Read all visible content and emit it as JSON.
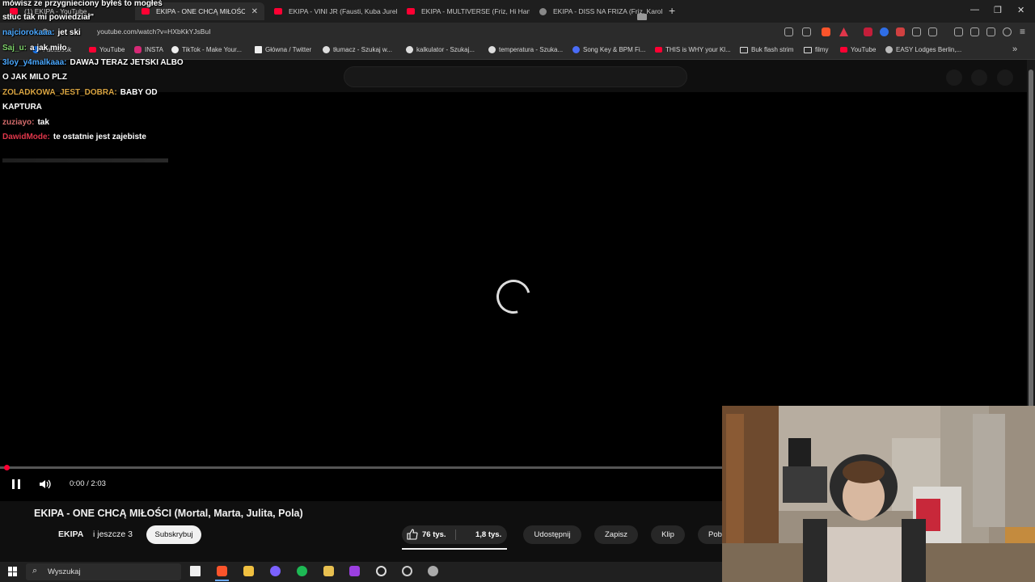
{
  "browser": {
    "tabs": [
      {
        "title": "(1) EKIPA - YouTube",
        "active": false
      },
      {
        "title": "EKIPA - ONE CHCĄ MIŁOŚCI (M",
        "active": true
      },
      {
        "title": "EKIPA - VINI JR (Fausti, Kuba Jurek) -",
        "active": false
      },
      {
        "title": "EKIPA - MULTIVERSE (Friz, Hi Hania, M",
        "active": false
      },
      {
        "title": "EKIPA - DISS NA FRIZA (Friz, Karol M",
        "active": false
      }
    ],
    "url": "youtube.com/watch?v=HXbKkYJsBuI",
    "bookmarks": [
      {
        "label": "Facebook",
        "icon": "facebook-icon"
      },
      {
        "label": "YouTube",
        "icon": "youtube-icon"
      },
      {
        "label": "INSTA",
        "icon": "instagram-icon"
      },
      {
        "label": "TikTok - Make Your...",
        "icon": "tiktok-icon"
      },
      {
        "label": "Główna / Twitter",
        "icon": "x-icon"
      },
      {
        "label": "tłumacz - Szukaj w...",
        "icon": "google-icon"
      },
      {
        "label": "kalkulator - Szukaj...",
        "icon": "google-icon"
      },
      {
        "label": "temperatura - Szuka...",
        "icon": "google-icon"
      },
      {
        "label": "Song Key & BPM Fi...",
        "icon": "music-icon"
      },
      {
        "label": "THIS is WHY your Kl...",
        "icon": "youtube-icon"
      },
      {
        "label": "Buk flash strim",
        "icon": "folder-icon"
      },
      {
        "label": "filmy",
        "icon": "folder-icon"
      },
      {
        "label": "YouTube",
        "icon": "youtube-icon"
      },
      {
        "label": "EASY Lodges Berlin,...",
        "icon": "globe-icon"
      }
    ]
  },
  "player": {
    "time": "0:00 / 2:03",
    "progress": 0.0,
    "state": "loading"
  },
  "video": {
    "title": "EKIPA - ONE CHCĄ MIŁOŚCI (Mortal, Marta, Julita, Pola)",
    "channel": "EKIPA",
    "coauthors": "i jeszcze 3",
    "subscribe": "Subskrybuj",
    "likes": "76 tys.",
    "dislikes": "1,8 tys.",
    "share": "Udostępnij",
    "save": "Zapisz",
    "clip": "Klip",
    "download": "Pob"
  },
  "chat": [
    {
      "user": "",
      "text": "mówisz ze przygnieciony byłeś to mogłeś",
      "color": "#ffffff"
    },
    {
      "user": "",
      "text": "stłuc tak mi powiedział\"",
      "color": "#ffffff"
    },
    {
      "user": "najciorokaaa",
      "text": "jet ski",
      "color": "#4aa8ff"
    },
    {
      "user": "Saj_u",
      "text": "a jak miło",
      "color": "#7fd36b"
    },
    {
      "user": "3loy_y4malkaaa",
      "text": "DAWAJ TERAZ JETSKI ALBO",
      "color": "#4aa8ff"
    },
    {
      "user": "",
      "text": "O JAK MILO PLZ",
      "color": "#ffffff"
    },
    {
      "user": "ZOLADKOWA_JEST_DOBRA",
      "text": "BABY OD",
      "color": "#d9a441"
    },
    {
      "user": "",
      "text": "KAPTURA",
      "color": "#ffffff"
    },
    {
      "user": "zuziayo",
      "text": "tak",
      "color": "#d36b6b"
    },
    {
      "user": "DawidMode",
      "text": "te ostatnie jest zajebiste",
      "color": "#e0364a"
    }
  ],
  "taskbar": {
    "search": "Wyszukaj"
  },
  "colors": {
    "accent": "#ff0033",
    "background": "#0f0f0f"
  }
}
